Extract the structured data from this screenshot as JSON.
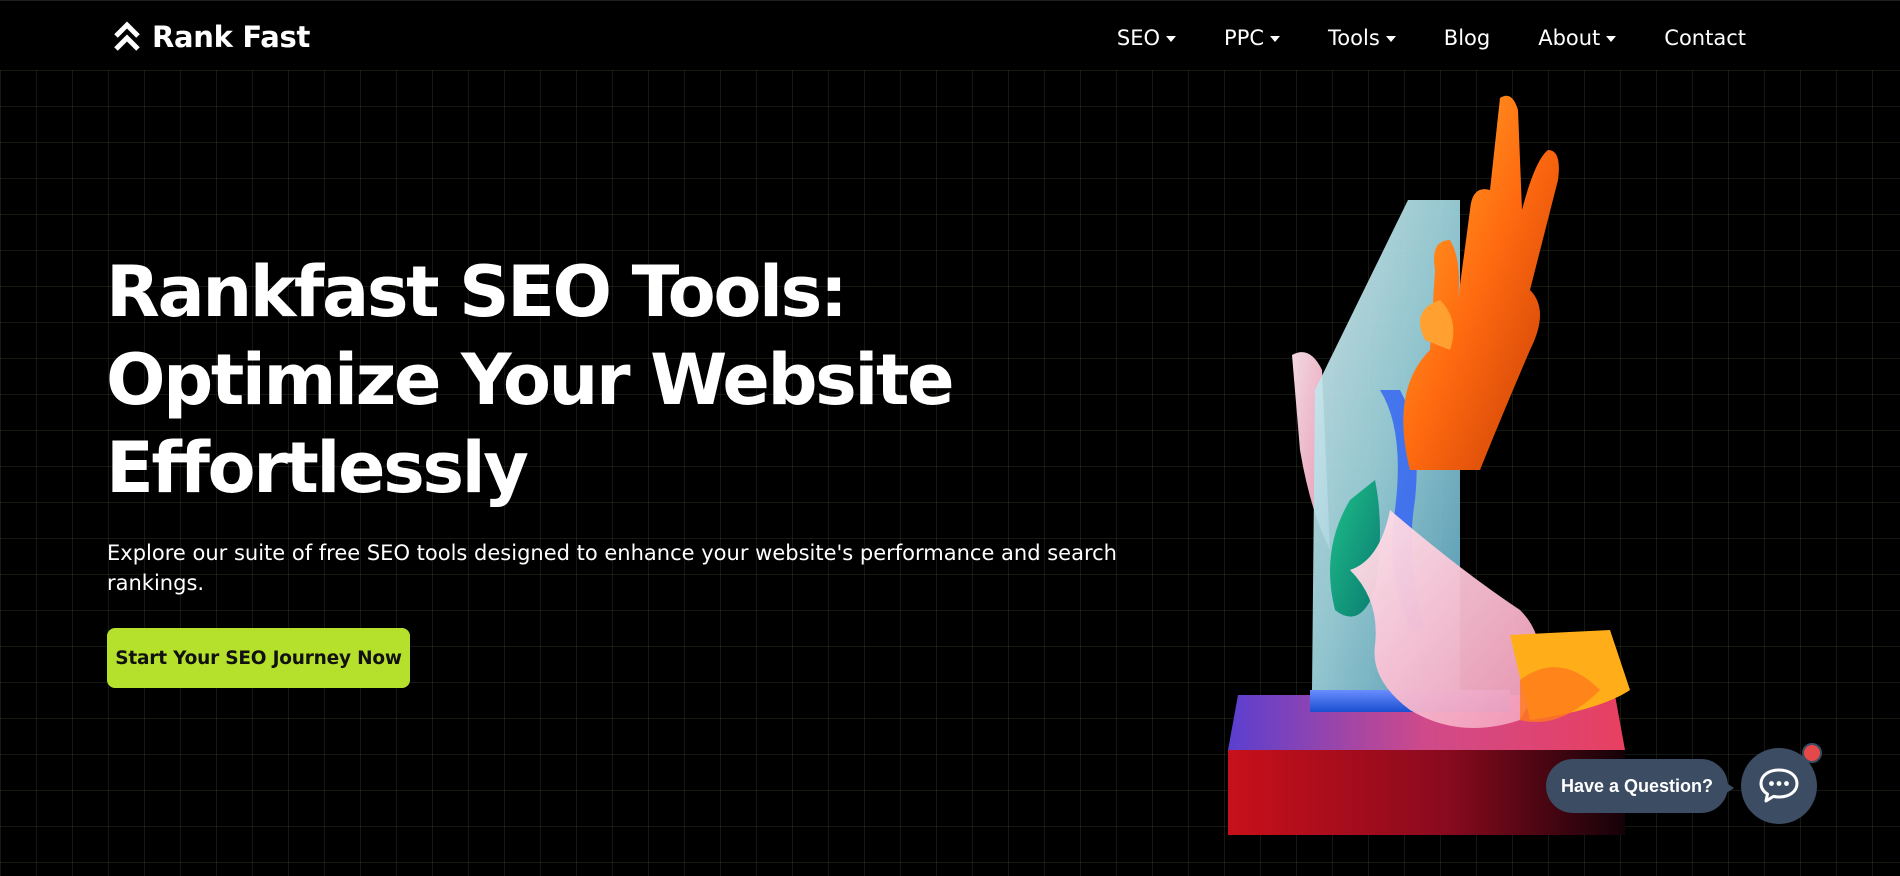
{
  "brand": {
    "name": "Rank Fast",
    "logo_icon": "double-chevron-up-icon"
  },
  "nav": {
    "items": [
      {
        "label": "SEO",
        "has_dropdown": true
      },
      {
        "label": "PPC",
        "has_dropdown": true
      },
      {
        "label": "Tools",
        "has_dropdown": true
      },
      {
        "label": "Blog",
        "has_dropdown": false
      },
      {
        "label": "About",
        "has_dropdown": true
      },
      {
        "label": "Contact",
        "has_dropdown": false
      }
    ]
  },
  "hero": {
    "title_lines": [
      "Rankfast SEO Tools:",
      "Optimize Your Website",
      "Effortlessly"
    ],
    "description": "Explore our suite of free SEO tools designed to enhance your website's performance and search rankings.",
    "cta_label": "Start Your SEO Journey Now"
  },
  "chat": {
    "prompt": "Have a Question?",
    "icon": "chat-bubble-icon"
  },
  "colors": {
    "background": "#000000",
    "accent": "#b5e02b",
    "chat": "#3b4c63",
    "notification": "#e54848"
  }
}
